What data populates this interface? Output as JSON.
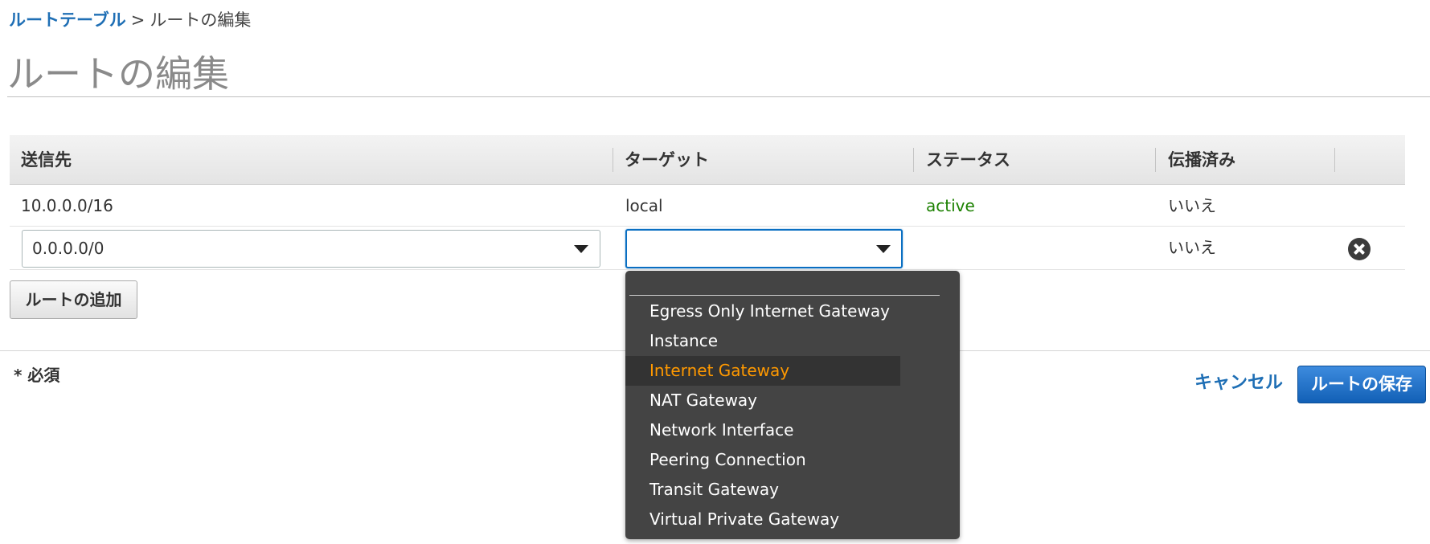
{
  "breadcrumb": {
    "parent": "ルートテーブル",
    "separator": ">",
    "current": "ルートの編集"
  },
  "page_title": "ルートの編集",
  "table": {
    "headers": [
      "送信先",
      "ターゲット",
      "ステータス",
      "伝播済み"
    ],
    "rows": [
      {
        "destination": "10.0.0.0/16",
        "target": "local",
        "status": "active",
        "propagated": "いいえ"
      }
    ],
    "edit_row": {
      "destination_value": "0.0.0.0/0",
      "target_value": "",
      "propagated": "いいえ",
      "remove_icon": "close-circle-icon"
    }
  },
  "dropdown": {
    "options": [
      "Egress Only Internet Gateway",
      "Instance",
      "Internet Gateway",
      "NAT Gateway",
      "Network Interface",
      "Peering Connection",
      "Transit Gateway",
      "Virtual Private Gateway"
    ],
    "highlighted_index": 2
  },
  "buttons": {
    "add_route": "ルートの追加",
    "cancel": "キャンセル",
    "save": "ルートの保存"
  },
  "required_note": "* 必須",
  "colors": {
    "link": "#1f6fb5",
    "status_active": "#1d8102",
    "primary_button": "#1260b6",
    "dropdown_bg": "#444444",
    "dropdown_highlight_text": "#ff9900"
  }
}
